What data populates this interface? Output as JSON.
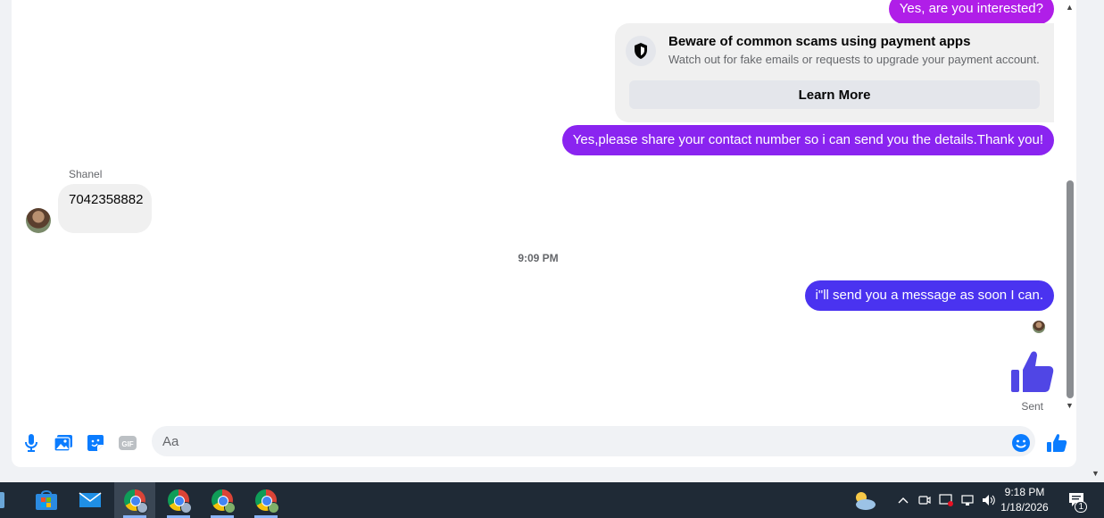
{
  "messages": {
    "outgoing_top": "Yes, are you interested?",
    "notice": {
      "title": "Beware of common scams using payment apps",
      "subtitle": "Watch out for fake emails or requests to upgrade your payment account.",
      "button": "Learn More"
    },
    "outgoing_details": "Yes,please share your contact number so i can send you the details.Thank you!",
    "sender_name": "Shanel",
    "incoming_number": "7042358882",
    "timestamp": "9:09 PM",
    "outgoing_last": "i\"ll send you a message as soon I can.",
    "sent_status": "Sent"
  },
  "composer": {
    "placeholder": "Aa"
  },
  "taskbar": {
    "time": "9:18 PM",
    "date": "1/18/2026",
    "notification_count": "1"
  },
  "colors": {
    "bubble_purple": "#a033ff",
    "bubble_violet": "#7a2cf5",
    "bubble_blue": "#4a3af0",
    "accent": "#0a7cff",
    "like": "#5046e5"
  },
  "icons": [
    "microphone-icon",
    "photo-icon",
    "sticker-icon",
    "gif-icon",
    "emoji-icon",
    "thumbs-up-icon",
    "shield-icon",
    "windows-store-icon",
    "mail-icon",
    "chrome-icon",
    "weather-icon",
    "notification-icon"
  ]
}
